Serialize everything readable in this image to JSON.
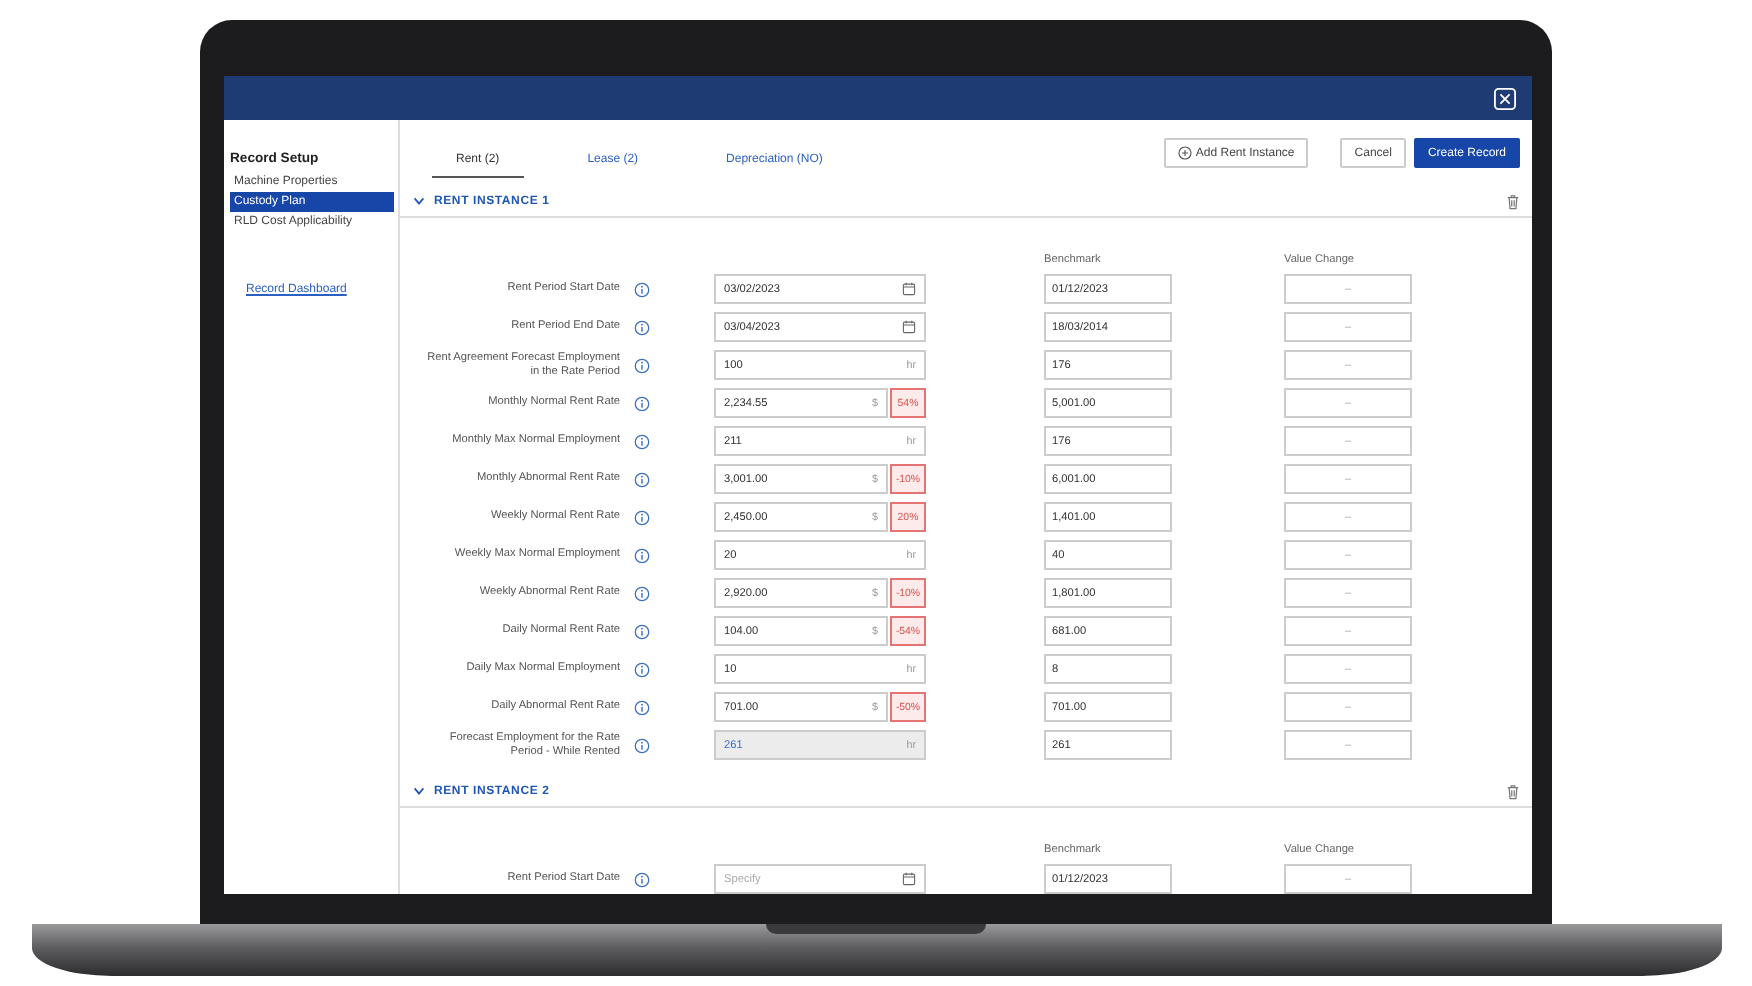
{
  "sidebar": {
    "title": "Record Setup",
    "items": [
      {
        "label": "Machine Properties",
        "selected": false
      },
      {
        "label": "Custody Plan",
        "selected": true
      },
      {
        "label": "RLD Cost Applicability",
        "selected": false
      }
    ],
    "link": "Record Dashboard"
  },
  "tabs": [
    {
      "label": "Rent (2)",
      "selected": true
    },
    {
      "label": "Lease (2)",
      "selected": false
    },
    {
      "label": "Depreciation (NO)",
      "selected": false
    }
  ],
  "actions": {
    "add": "Add Rent Instance",
    "cancel": "Cancel",
    "create": "Create Record"
  },
  "instances": [
    {
      "title": "RENT INSTANCE 1",
      "expanded": true,
      "columns": [
        "Benchmark",
        "Value Change"
      ],
      "rows": [
        {
          "label": "Rent Period Start Date",
          "kind": "date",
          "value": "03/02/2023",
          "benchmark": "01/12/2023",
          "value_change": "–",
          "disabled": false
        },
        {
          "label": "Rent Period End Date",
          "kind": "date",
          "value": "03/04/2023",
          "benchmark": "18/03/2014",
          "value_change": "–",
          "disabled": false
        },
        {
          "label": "Rent Agreement Forecast Employment in the Rate Period",
          "kind": "number",
          "value": "100",
          "unit": "hr",
          "benchmark": "176",
          "value_change": "–",
          "disabled": false
        },
        {
          "label": "Monthly Normal Rent Rate",
          "kind": "number",
          "value": "2,234.55",
          "unit": "$",
          "badge": "54%",
          "benchmark": "5,001.00",
          "value_change": "–",
          "disabled": false
        },
        {
          "label": "Monthly Max Normal Employment",
          "kind": "number",
          "value": "211",
          "unit": "hr",
          "benchmark": "176",
          "value_change": "–",
          "disabled": false
        },
        {
          "label": "Monthly Abnormal Rent Rate",
          "kind": "number",
          "value": "3,001.00",
          "unit": "$",
          "badge": "-10%",
          "benchmark": "6,001.00",
          "value_change": "–",
          "disabled": false
        },
        {
          "label": "Weekly Normal Rent Rate",
          "kind": "number",
          "value": "2,450.00",
          "unit": "$",
          "badge": "20%",
          "benchmark": "1,401.00",
          "value_change": "–",
          "disabled": false
        },
        {
          "label": "Weekly Max Normal Employment",
          "kind": "number",
          "value": "20",
          "unit": "hr",
          "benchmark": "40",
          "value_change": "–",
          "disabled": false
        },
        {
          "label": "Weekly Abnormal Rent Rate",
          "kind": "number",
          "value": "2,920.00",
          "unit": "$",
          "badge": "-10%",
          "benchmark": "1,801.00",
          "value_change": "–",
          "disabled": false
        },
        {
          "label": "Daily Normal Rent Rate",
          "kind": "number",
          "value": "104.00",
          "unit": "$",
          "badge": "-54%",
          "benchmark": "681.00",
          "value_change": "–",
          "disabled": false
        },
        {
          "label": "Daily Max Normal Employment",
          "kind": "number",
          "value": "10",
          "unit": "hr",
          "benchmark": "8",
          "value_change": "–",
          "disabled": false
        },
        {
          "label": "Daily Abnormal Rent Rate",
          "kind": "number",
          "value": "701.00",
          "unit": "$",
          "badge": "-50%",
          "benchmark": "701.00",
          "value_change": "–",
          "disabled": false
        },
        {
          "label": "Forecast Employment for the Rate Period - While Rented",
          "kind": "number",
          "value": "261",
          "unit": "hr",
          "benchmark": "261",
          "value_change": "–",
          "disabled": true
        }
      ]
    },
    {
      "title": "RENT INSTANCE 2",
      "expanded": true,
      "columns": [
        "Benchmark",
        "Value Change"
      ],
      "rows": [
        {
          "label": "Rent Period Start Date",
          "kind": "date",
          "placeholder": "Specify",
          "benchmark": "01/12/2023",
          "value_change": "–",
          "disabled": false
        }
      ]
    }
  ]
}
